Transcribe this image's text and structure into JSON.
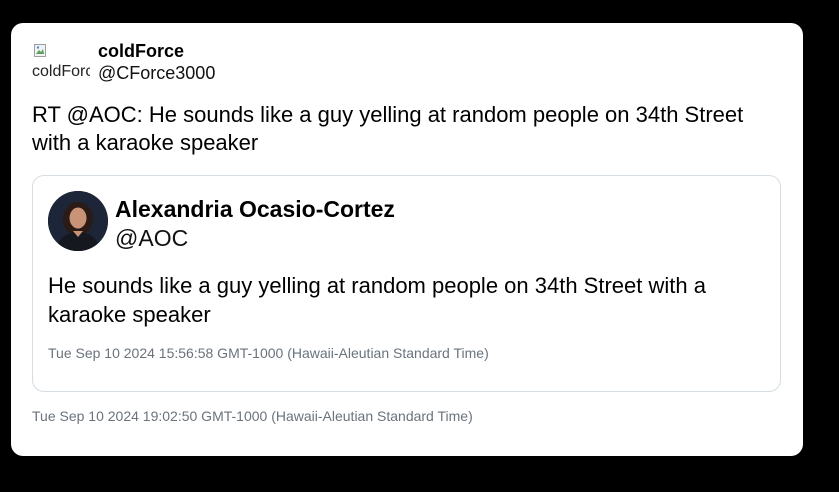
{
  "retweeter": {
    "display_name": "coldForce",
    "handle": "@CForce3000",
    "avatar_alt": "coldForce"
  },
  "tweet": {
    "text": "RT @AOC: He sounds like a guy yelling at random people on 34th Street with a karaoke speaker",
    "timestamp": "Tue Sep 10 2024 19:02:50 GMT-1000 (Hawaii-Aleutian Standard Time)"
  },
  "quoted": {
    "display_name": "Alexandria Ocasio-Cortez",
    "handle": "@AOC",
    "text": "He sounds like a guy yelling at random people on 34th Street with a karaoke speaker",
    "timestamp": "Tue Sep 10 2024 15:56:58 GMT-1000 (Hawaii-Aleutian Standard Time)"
  }
}
